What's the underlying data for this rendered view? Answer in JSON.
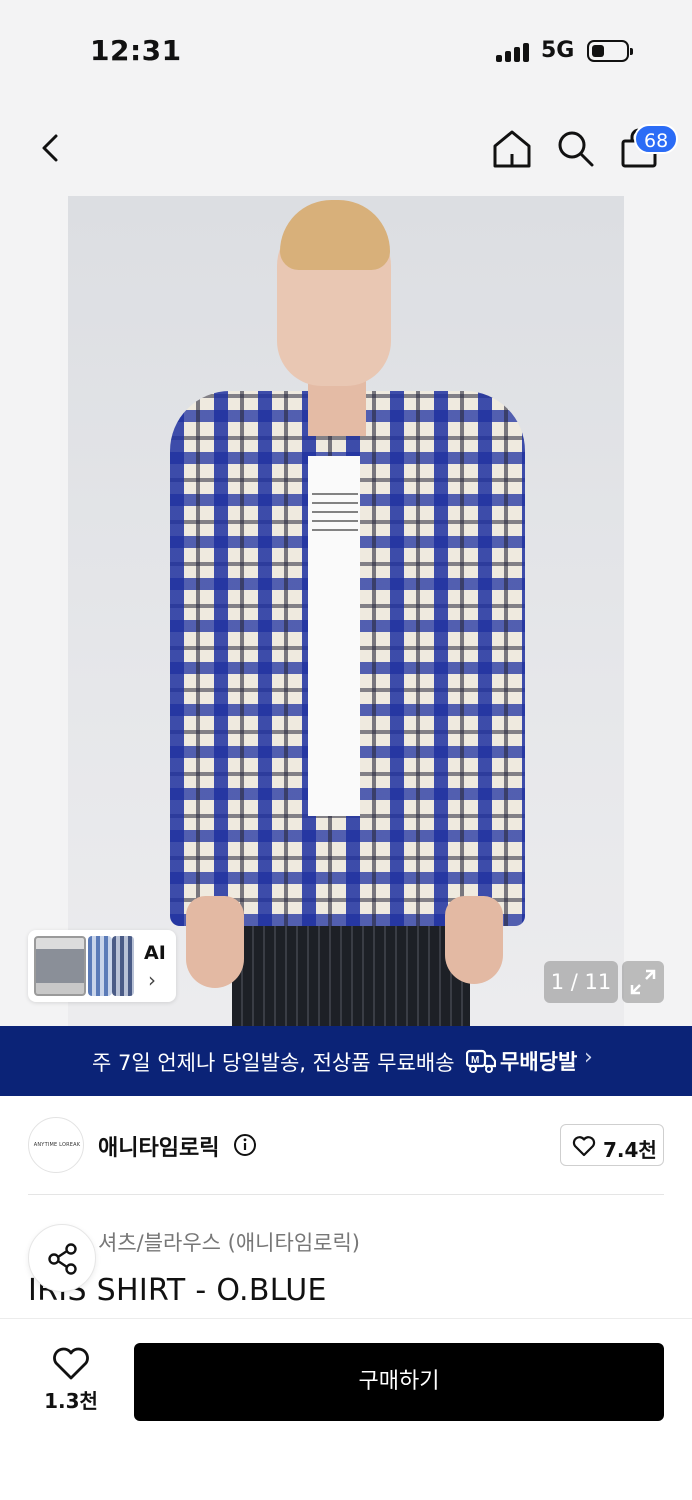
{
  "status_bar": {
    "time": "12:31",
    "network": "5G"
  },
  "nav": {
    "cart_count": "68"
  },
  "gallery": {
    "page_indicator": "1 / 11",
    "ai_label": "AI",
    "ai_chevron": "›"
  },
  "banner": {
    "text": "주 7일 언제나 당일발송, 전상품 무료배송",
    "logo_text": "무배당발",
    "chevron": "›"
  },
  "brand": {
    "logo_text": "ANYTIME LOREAK",
    "name": "애니타임로릭",
    "like_count": "7.4천"
  },
  "product": {
    "category": "셔츠/블라우스 (애니타임로릭)",
    "title": "IRIS SHIRT - O.BLUE"
  },
  "bottom_bar": {
    "like_count": "1.3천",
    "buy_label": "구매하기"
  },
  "colors": {
    "banner_bg": "#0b2377",
    "badge_bg": "#2b6cf6",
    "buy_bg": "#000000"
  }
}
